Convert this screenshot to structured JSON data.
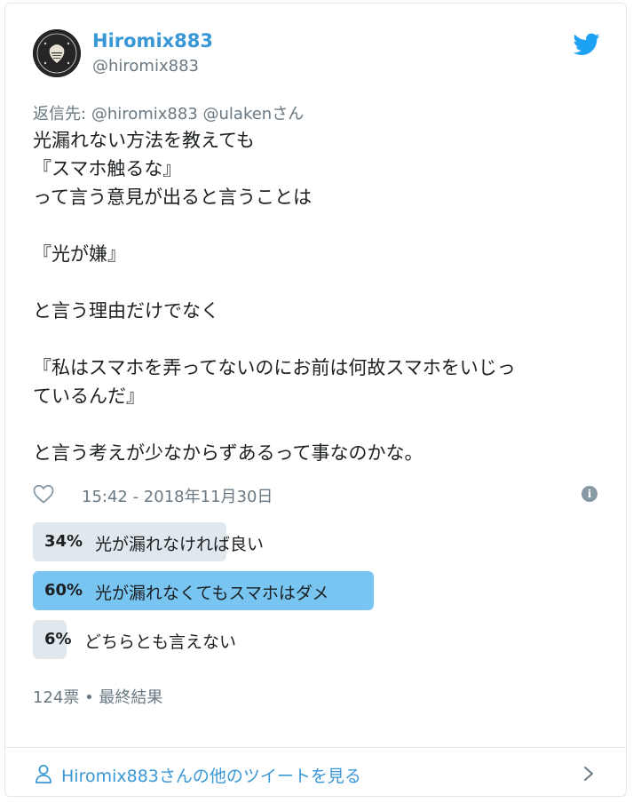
{
  "author": {
    "display_name": "Hiromix883",
    "handle": "@hiromix883"
  },
  "reply_to": {
    "prefix": "返信先:",
    "mentions": "@hiromix883 @ulaken",
    "suffix": "さん"
  },
  "tweet": {
    "text": "光漏れない方法を教えても\n『スマホ触るな』\nって言う意見が出ると言うことは\n\n『光が嫌』\n\nと言う理由だけでなく\n\n『私はスマホを弄ってないのにお前は何故スマホをいじっ\nているんだ』\n\nと言う考えが少なからずあるって事なのかな。",
    "timestamp": "15:42 - 2018年11月30日"
  },
  "poll": {
    "options": [
      {
        "percent_label": "34%",
        "percent": 34,
        "label": "光が漏れなければ良い",
        "winner": false
      },
      {
        "percent_label": "60%",
        "percent": 60,
        "label": "光が漏れなくてもスマホはダメ",
        "winner": true
      },
      {
        "percent_label": "6%",
        "percent": 6,
        "label": "どちらとも言えない",
        "winner": false
      }
    ],
    "summary": "124票 • 最終結果"
  },
  "footer": {
    "link_text": "Hiromix883さんの他のツイートを見る"
  },
  "colors": {
    "link_blue": "#3a97d6",
    "bar_gray": "#e1e8ed",
    "bar_winner": "#79c5f2",
    "muted": "#697882"
  },
  "icons": [
    "twitter-bird-icon",
    "heart-icon",
    "info-icon",
    "person-icon",
    "chevron-right-icon"
  ]
}
